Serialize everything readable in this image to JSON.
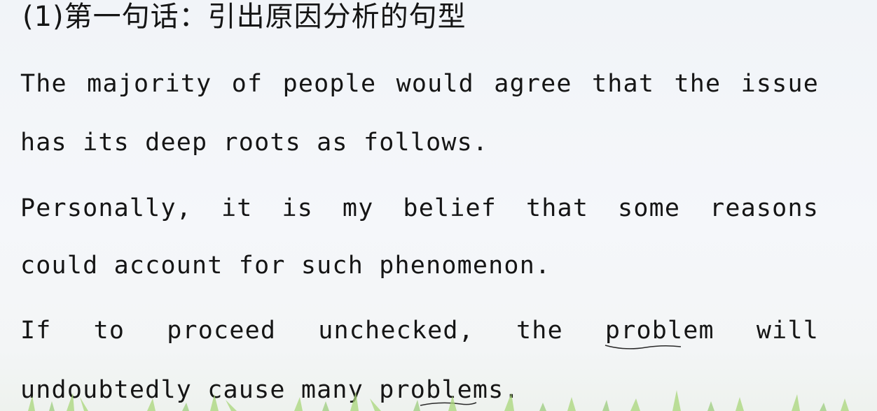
{
  "document": {
    "heading": "(1)第一句话：引出原因分析的句型",
    "lines": [
      "The majority of people would agree that the issue",
      "has its deep roots as follows.",
      "Personally, it is my belief that  some reasons",
      "could account for such phenomenon.",
      "If to proceed unchecked, the problem will",
      "undoubtedly cause many problems."
    ]
  },
  "colors": {
    "background": "#f3f5f8",
    "text": "#151515",
    "grass": "#a9d67a"
  }
}
